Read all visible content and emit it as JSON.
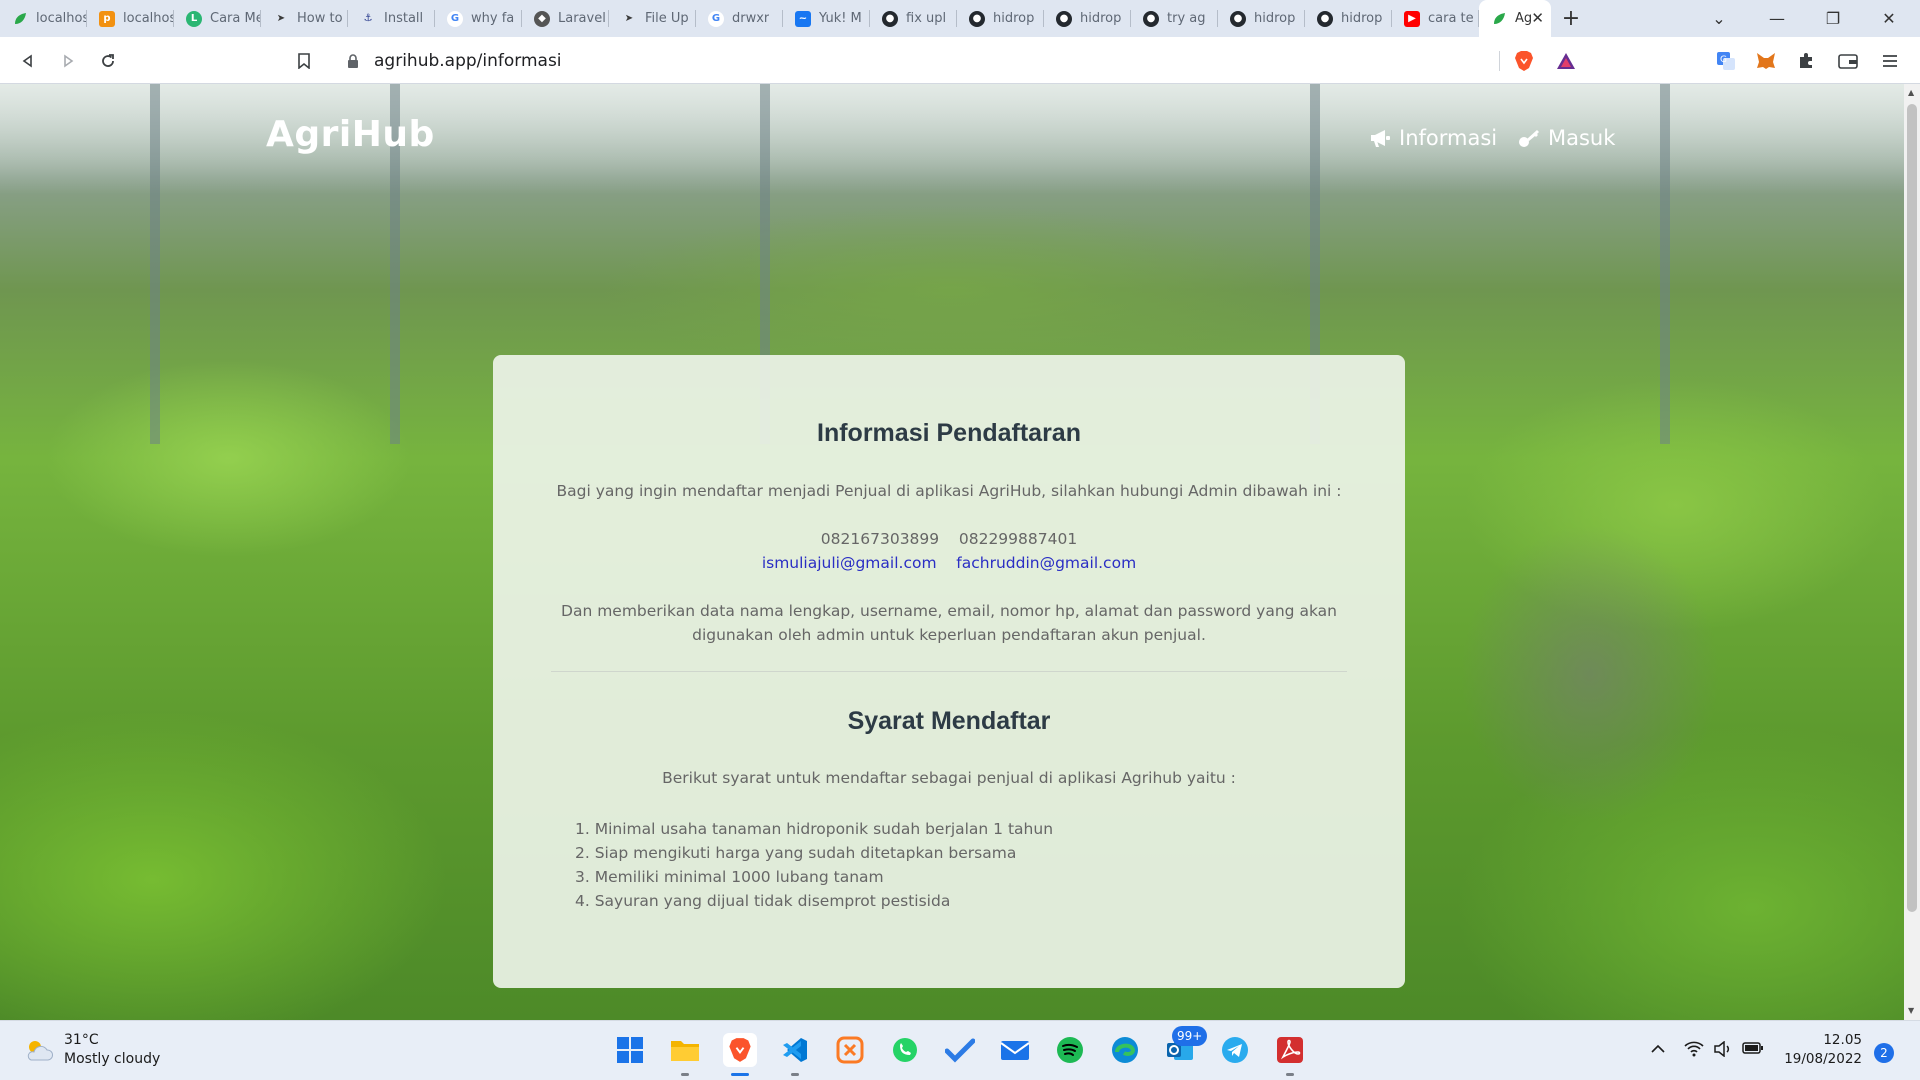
{
  "browser": {
    "tabs": [
      {
        "title": "localhost",
        "icon": "leaf-icon",
        "color": "#2aa84a"
      },
      {
        "title": "localhost",
        "icon": "phpmyadmin-icon",
        "color": "#f29111"
      },
      {
        "title": "Cara Membuat",
        "icon": "letter-l-icon",
        "color": "#2bb673"
      },
      {
        "title": "How to",
        "icon": "paper-plane-icon",
        "color": "#3b3b3b"
      },
      {
        "title": "Install",
        "icon": "hook-icon",
        "color": "#2c3e8f"
      },
      {
        "title": "why fa",
        "icon": "google-icon",
        "color": "#4285f4"
      },
      {
        "title": "Laravel",
        "icon": "laravel-icon",
        "color": "#555555"
      },
      {
        "title": "File Up",
        "icon": "paper-plane-icon",
        "color": "#3b3b3b"
      },
      {
        "title": "drwxr",
        "icon": "google-icon",
        "color": "#4285f4"
      },
      {
        "title": "Yuk! M",
        "icon": "messenger-icon",
        "color": "#1877f2"
      },
      {
        "title": "fix upl",
        "icon": "github-icon",
        "color": "#24292f"
      },
      {
        "title": "hidrop",
        "icon": "github-icon",
        "color": "#24292f"
      },
      {
        "title": "hidrop",
        "icon": "github-icon",
        "color": "#24292f"
      },
      {
        "title": "try ag",
        "icon": "github-icon",
        "color": "#24292f"
      },
      {
        "title": "hidrop",
        "icon": "github-icon",
        "color": "#24292f"
      },
      {
        "title": "hidrop",
        "icon": "github-icon",
        "color": "#24292f"
      },
      {
        "title": "cara te",
        "icon": "youtube-icon",
        "color": "#ff0000"
      },
      {
        "title": "Ag",
        "icon": "leaf-icon",
        "color": "#2aa84a",
        "active": true
      }
    ],
    "url": "agrihub.app/informasi"
  },
  "site": {
    "brand": "AgriHub",
    "nav": {
      "informasi": "Informasi",
      "masuk": "Masuk"
    }
  },
  "card": {
    "heading1": "Informasi Pendaftaran",
    "intro": "Bagi yang ingin mendaftar menjadi Penjual di aplikasi AgriHub, silahkan hubungi Admin dibawah ini :",
    "phone1": "082167303899",
    "phone2": "082299887401",
    "email1": "ismuliajuli@gmail.com",
    "email2": "fachruddin@gmail.com",
    "details_line1": "Dan memberikan data nama lengkap, username, email, nomor hp, alamat dan password yang akan",
    "details_line2": "digunakan oleh admin untuk keperluan pendaftaran akun penjual.",
    "heading2": "Syarat Mendaftar",
    "requirements_intro": "Berikut syarat untuk mendaftar sebagai penjual di aplikasi Agrihub yaitu :",
    "requirements": [
      "1. Minimal usaha tanaman hidroponik sudah berjalan 1 tahun",
      "2. Siap mengikuti harga yang sudah ditetapkan bersama",
      "3. Memiliki minimal 1000 lubang tanam",
      "4. Sayuran yang dijual tidak disemprot pestisida"
    ]
  },
  "taskbar": {
    "weather_temp": "31°C",
    "weather_desc": "Mostly cloudy",
    "mail_badge": "99+",
    "time": "12.05",
    "date": "19/08/2022",
    "notification_count": "2"
  }
}
